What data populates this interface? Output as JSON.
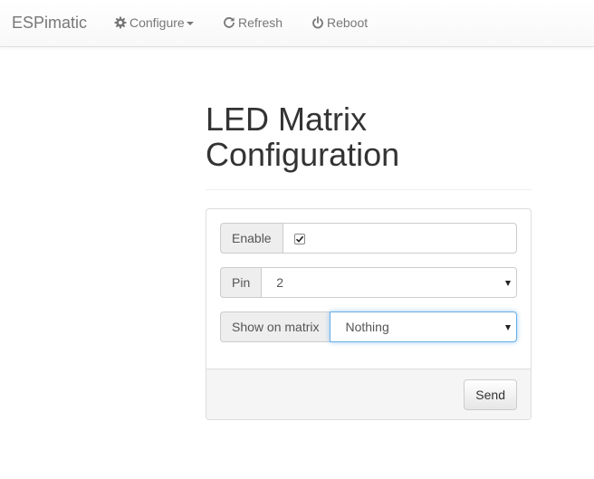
{
  "nav": {
    "brand": "ESPimatic",
    "configure_label": "Configure",
    "refresh_label": "Refresh",
    "reboot_label": "Reboot"
  },
  "page": {
    "title": "LED Matrix Configuration"
  },
  "form": {
    "enable": {
      "label": "Enable",
      "checked": true
    },
    "pin": {
      "label": "Pin",
      "value": "2"
    },
    "show_on_matrix": {
      "label": "Show on matrix",
      "value": "Nothing"
    },
    "send_label": "Send"
  },
  "colors": {
    "focus_border": "#66afe9",
    "nav_text": "#777777",
    "addon_bg": "#eeeeee"
  },
  "icons": {
    "configure": "gear-icon",
    "refresh": "refresh-icon",
    "reboot": "power-icon",
    "dropdown": "caret-down-icon"
  }
}
